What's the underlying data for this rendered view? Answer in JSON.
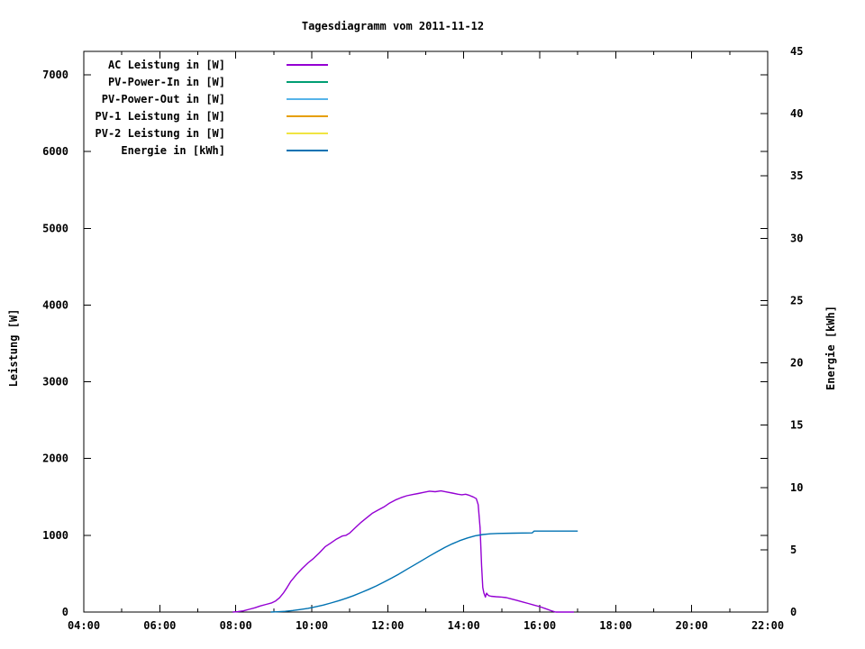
{
  "page": {
    "title": "Tagesdiagramm vom 2011-11-12"
  },
  "chart_data": {
    "type": "line",
    "title": "Tagesdiagramm vom 2011-11-12",
    "xlabel": "",
    "ylabel": "Leistung [W]",
    "y2label": "Energie [kWh]",
    "grid": false,
    "legend_position": "top-left-inside",
    "x_range_hours": [
      4,
      22
    ],
    "x_ticks": [
      {
        "hour": 4,
        "label": "04:00"
      },
      {
        "hour": 6,
        "label": "06:00"
      },
      {
        "hour": 8,
        "label": "08:00"
      },
      {
        "hour": 10,
        "label": "10:00"
      },
      {
        "hour": 12,
        "label": "12:00"
      },
      {
        "hour": 14,
        "label": "14:00"
      },
      {
        "hour": 16,
        "label": "16:00"
      },
      {
        "hour": 18,
        "label": "18:00"
      },
      {
        "hour": 20,
        "label": "20:00"
      },
      {
        "hour": 22,
        "label": "22:00"
      }
    ],
    "x_minor_hours": [
      5,
      7,
      9,
      11,
      13,
      15,
      17,
      19,
      21
    ],
    "y_axis": {
      "range": [
        0,
        7300
      ],
      "tick_step": 1000
    },
    "y_ticks": [
      {
        "value": 0,
        "label": "0"
      },
      {
        "value": 1000,
        "label": "1000"
      },
      {
        "value": 2000,
        "label": "2000"
      },
      {
        "value": 3000,
        "label": "3000"
      },
      {
        "value": 4000,
        "label": "4000"
      },
      {
        "value": 5000,
        "label": "5000"
      },
      {
        "value": 6000,
        "label": "6000"
      },
      {
        "value": 7000,
        "label": "7000"
      }
    ],
    "y2_axis": {
      "range": [
        0,
        45
      ],
      "tick_step": 5
    },
    "y2_ticks": [
      {
        "value": 0,
        "label": "0"
      },
      {
        "value": 5,
        "label": "5"
      },
      {
        "value": 10,
        "label": "10"
      },
      {
        "value": 15,
        "label": "15"
      },
      {
        "value": 20,
        "label": "20"
      },
      {
        "value": 25,
        "label": "25"
      },
      {
        "value": 30,
        "label": "30"
      },
      {
        "value": 35,
        "label": "35"
      },
      {
        "value": 40,
        "label": "40"
      },
      {
        "value": 45,
        "label": "45"
      }
    ],
    "series": [
      {
        "name": "AC Leistung in [W]",
        "color": "#9400D3",
        "axis": "y1",
        "points": [
          [
            7.92,
            0
          ],
          [
            8.05,
            5
          ],
          [
            8.2,
            15
          ],
          [
            8.35,
            35
          ],
          [
            8.5,
            55
          ],
          [
            8.65,
            80
          ],
          [
            8.8,
            100
          ],
          [
            8.95,
            120
          ],
          [
            9.05,
            145
          ],
          [
            9.15,
            185
          ],
          [
            9.25,
            245
          ],
          [
            9.35,
            320
          ],
          [
            9.45,
            400
          ],
          [
            9.6,
            490
          ],
          [
            9.75,
            570
          ],
          [
            9.9,
            640
          ],
          [
            10.05,
            700
          ],
          [
            10.2,
            770
          ],
          [
            10.35,
            850
          ],
          [
            10.5,
            900
          ],
          [
            10.65,
            950
          ],
          [
            10.8,
            990
          ],
          [
            10.9,
            1000
          ],
          [
            11.0,
            1030
          ],
          [
            11.15,
            1100
          ],
          [
            11.3,
            1170
          ],
          [
            11.45,
            1230
          ],
          [
            11.6,
            1290
          ],
          [
            11.75,
            1330
          ],
          [
            11.9,
            1370
          ],
          [
            12.05,
            1420
          ],
          [
            12.2,
            1460
          ],
          [
            12.35,
            1490
          ],
          [
            12.5,
            1515
          ],
          [
            12.65,
            1530
          ],
          [
            12.8,
            1545
          ],
          [
            12.95,
            1560
          ],
          [
            13.1,
            1575
          ],
          [
            13.25,
            1568
          ],
          [
            13.4,
            1578
          ],
          [
            13.55,
            1565
          ],
          [
            13.7,
            1550
          ],
          [
            13.85,
            1535
          ],
          [
            13.95,
            1528
          ],
          [
            14.05,
            1535
          ],
          [
            14.15,
            1520
          ],
          [
            14.25,
            1500
          ],
          [
            14.33,
            1478
          ],
          [
            14.38,
            1400
          ],
          [
            14.43,
            1100
          ],
          [
            14.47,
            600
          ],
          [
            14.5,
            320
          ],
          [
            14.53,
            250
          ],
          [
            14.57,
            195
          ],
          [
            14.6,
            245
          ],
          [
            14.65,
            215
          ],
          [
            14.72,
            205
          ],
          [
            14.85,
            200
          ],
          [
            15.0,
            195
          ],
          [
            15.12,
            188
          ],
          [
            15.25,
            172
          ],
          [
            15.4,
            152
          ],
          [
            15.55,
            132
          ],
          [
            15.7,
            112
          ],
          [
            15.85,
            90
          ],
          [
            16.0,
            70
          ],
          [
            16.15,
            45
          ],
          [
            16.3,
            18
          ],
          [
            16.42,
            0
          ],
          [
            16.9,
            0
          ]
        ]
      },
      {
        "name": "PV-Power-In in [W]",
        "color": "#009E73",
        "axis": "y1",
        "points": []
      },
      {
        "name": "PV-Power-Out in [W]",
        "color": "#56B4E9",
        "axis": "y1",
        "points": []
      },
      {
        "name": "PV-1 Leistung in [W]",
        "color": "#E69F00",
        "axis": "y1",
        "points": []
      },
      {
        "name": "PV-2 Leistung in [W]",
        "color": "#F0E442",
        "axis": "y1",
        "points": []
      },
      {
        "name": "Energie in [kWh]",
        "color": "#0072B2",
        "axis": "y2",
        "points": [
          [
            8.92,
            0
          ],
          [
            9.1,
            0.02
          ],
          [
            9.3,
            0.06
          ],
          [
            9.5,
            0.12
          ],
          [
            9.7,
            0.2
          ],
          [
            9.9,
            0.3
          ],
          [
            10.1,
            0.42
          ],
          [
            10.3,
            0.56
          ],
          [
            10.5,
            0.72
          ],
          [
            10.7,
            0.9
          ],
          [
            10.9,
            1.1
          ],
          [
            11.1,
            1.32
          ],
          [
            11.3,
            1.56
          ],
          [
            11.5,
            1.82
          ],
          [
            11.7,
            2.1
          ],
          [
            11.9,
            2.4
          ],
          [
            12.1,
            2.72
          ],
          [
            12.3,
            3.06
          ],
          [
            12.5,
            3.42
          ],
          [
            12.7,
            3.78
          ],
          [
            12.9,
            4.14
          ],
          [
            13.1,
            4.5
          ],
          [
            13.3,
            4.85
          ],
          [
            13.5,
            5.18
          ],
          [
            13.7,
            5.48
          ],
          [
            13.9,
            5.74
          ],
          [
            14.1,
            5.95
          ],
          [
            14.3,
            6.12
          ],
          [
            14.5,
            6.22
          ],
          [
            14.7,
            6.28
          ],
          [
            14.9,
            6.31
          ],
          [
            15.3,
            6.33
          ],
          [
            15.8,
            6.35
          ],
          [
            15.85,
            6.5
          ],
          [
            16.4,
            6.5
          ],
          [
            17.0,
            6.5
          ]
        ]
      }
    ]
  }
}
